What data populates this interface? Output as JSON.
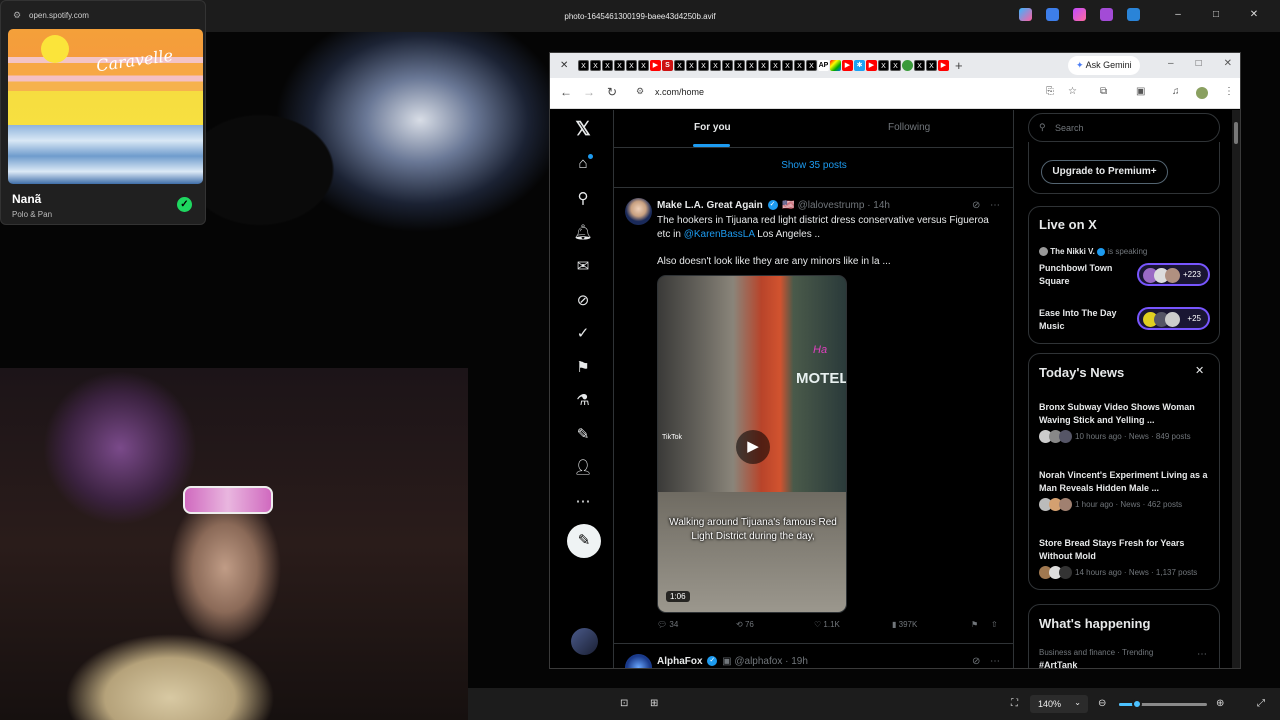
{
  "viewer": {
    "title": "photo-1645461300199-baee43d4250b.avif",
    "zoom_label": "140%",
    "zoom_level_percent": 140,
    "window_controls": [
      "–",
      "□",
      "✕"
    ]
  },
  "spotify": {
    "url": "open.spotify.com",
    "song": "Nanã",
    "artist": "Polo & Pan",
    "album_script": "Caravelle"
  },
  "browser": {
    "url": "x.com/home",
    "gemini_label": "Ask Gemini",
    "new_tab": "+",
    "tab_close": "✕"
  },
  "x": {
    "tabs": [
      "For you",
      "Following"
    ],
    "show_posts": "Show 35 posts",
    "tweet1": {
      "name": "Make L.A. Great Again",
      "flag": "🇺🇸",
      "handle": "@lalovestrump",
      "time": "· 14h",
      "text_a": "The hookers in Tijuana red light district dress conservative versus Figueroa etc in ",
      "mention": "@KarenBassLA",
      "text_b": " Los Angeles ..",
      "text_c": "Also doesn't look like they are any minors like in la ...",
      "video_caption": "Walking around Tijuana's famous Red Light District during the day,",
      "video_duration": "1:06",
      "video_motel": "MOTEL",
      "tiktok": "TikTok",
      "replies": "34",
      "reposts": "76",
      "likes": "1.1K",
      "views": "397K"
    },
    "tweet2": {
      "name": "AlphaFox",
      "handle": "@alphafox",
      "time": "· 19h"
    },
    "search_placeholder": "Search",
    "premium_button": "Upgrade to Premium+",
    "live": {
      "heading": "Live on X",
      "host": "The Nikki V.",
      "speaking": "is speaking",
      "space1": "Punchbowl Town Square",
      "space1_count": "+223",
      "space2": "Ease Into The Day Music",
      "space2_count": "+25"
    },
    "news": {
      "heading": "Today's News",
      "items": [
        {
          "headline": "Bronx Subway Video Shows Woman Waving Stick and Yelling ...",
          "meta": "10 hours ago · News · 849 posts"
        },
        {
          "headline": "Norah Vincent's Experiment Living as a Man Reveals Hidden Male ...",
          "meta": "1 hour ago · News · 462 posts"
        },
        {
          "headline": "Store Bread Stays Fresh for Years Without Mold",
          "meta": "14 hours ago · News · 1,137 posts"
        }
      ]
    },
    "happening": {
      "heading": "What's happening",
      "category": "Business and finance · Trending",
      "trend": "#ArtTank"
    }
  },
  "colors": {
    "x_blue": "#1d9bf0",
    "spotify_green": "#1ed760",
    "space_purple": "#7856ff"
  }
}
